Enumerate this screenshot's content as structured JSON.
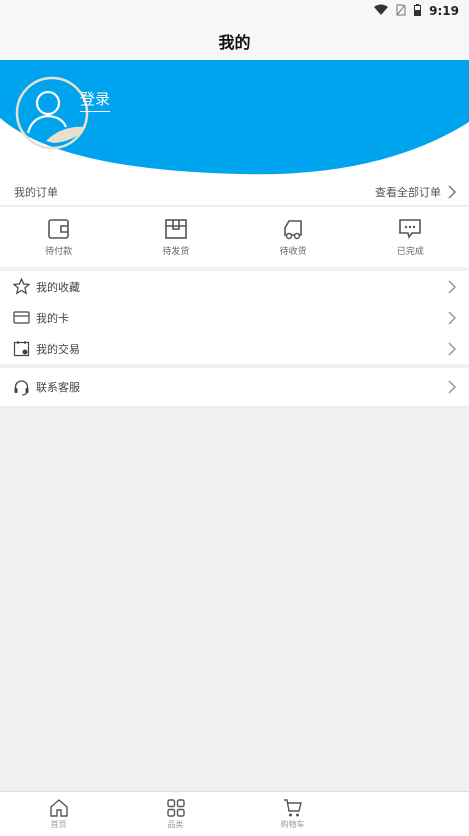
{
  "status": {
    "time": "9:19"
  },
  "title": "我的",
  "header": {
    "login_label": "登录"
  },
  "orders": {
    "title": "我的订单",
    "view_all": "查看全部订单",
    "items": [
      {
        "label": "待付款",
        "icon": "wallet-icon"
      },
      {
        "label": "待发货",
        "icon": "box-icon"
      },
      {
        "label": "待收货",
        "icon": "truck-icon"
      },
      {
        "label": "已完成",
        "icon": "chat-icon"
      }
    ]
  },
  "menu": [
    {
      "label": "我的收藏",
      "icon": "star-icon"
    },
    {
      "label": "我的卡",
      "icon": "card-icon"
    },
    {
      "label": "我的交易",
      "icon": "calendar-icon"
    },
    {
      "label": "联系客服",
      "icon": "headset-icon"
    }
  ],
  "tabs": [
    {
      "label": "首页",
      "icon": "home-icon"
    },
    {
      "label": "品类",
      "icon": "grid-icon"
    },
    {
      "label": "购物车",
      "icon": "cart-icon"
    }
  ],
  "colors": {
    "accent": "#00a3ee"
  }
}
